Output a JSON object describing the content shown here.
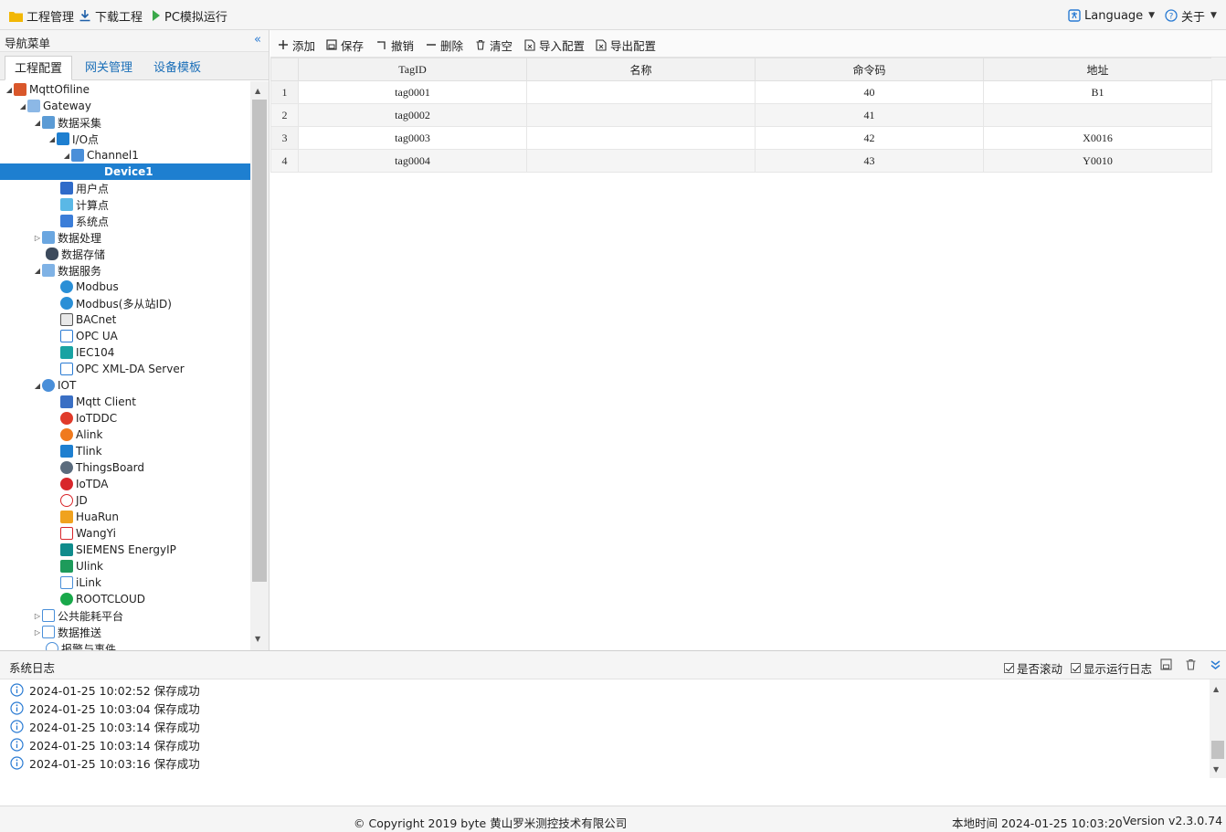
{
  "menubar": {
    "project": "工程管理",
    "download": "下载工程",
    "simulate": "PC模拟运行",
    "language": "Language",
    "about": "关于"
  },
  "nav": {
    "title": "导航菜单",
    "tabs": [
      "工程配置",
      "网关管理",
      "设备模板"
    ],
    "tree": [
      {
        "label": "MqttOfiline",
        "icon": "project-icon"
      },
      {
        "label": "Gateway",
        "icon": "gateway-icon"
      },
      {
        "label": "数据采集",
        "icon": "collect-icon"
      },
      {
        "label": "I/O点",
        "icon": "io-icon"
      },
      {
        "label": "Channel1",
        "icon": "channel-icon"
      },
      {
        "label": "Device1",
        "icon": "device-icon"
      },
      {
        "label": "用户点",
        "icon": "user-point-icon"
      },
      {
        "label": "计算点",
        "icon": "calc-point-icon"
      },
      {
        "label": "系统点",
        "icon": "system-point-icon"
      },
      {
        "label": "数据处理",
        "icon": "process-icon"
      },
      {
        "label": "数据存储",
        "icon": "database-icon"
      },
      {
        "label": "数据服务",
        "icon": "service-icon"
      },
      {
        "label": "Modbus",
        "icon": "modbus-icon"
      },
      {
        "label": "Modbus(多从站ID)",
        "icon": "modbus-icon"
      },
      {
        "label": "BACnet",
        "icon": "bacnet-icon"
      },
      {
        "label": "OPC UA",
        "icon": "opcua-icon"
      },
      {
        "label": "IEC104",
        "icon": "iec104-icon"
      },
      {
        "label": "OPC XML-DA Server",
        "icon": "opcxml-icon"
      },
      {
        "label": "IOT",
        "icon": "iot-icon"
      },
      {
        "label": "Mqtt Client",
        "icon": "mqtt-icon"
      },
      {
        "label": "IoTDDC",
        "icon": "iotddc-icon"
      },
      {
        "label": "Alink",
        "icon": "alink-icon"
      },
      {
        "label": "Tlink",
        "icon": "tlink-icon"
      },
      {
        "label": "ThingsBoard",
        "icon": "thingsboard-icon"
      },
      {
        "label": "IoTDA",
        "icon": "huawei-icon"
      },
      {
        "label": "JD",
        "icon": "jd-icon"
      },
      {
        "label": "HuaRun",
        "icon": "huarun-icon"
      },
      {
        "label": "WangYi",
        "icon": "wangyi-icon"
      },
      {
        "label": "SIEMENS EnergyIP",
        "icon": "siemens-icon"
      },
      {
        "label": "Ulink",
        "icon": "ulink-icon"
      },
      {
        "label": "iLink",
        "icon": "ilink-icon"
      },
      {
        "label": "ROOTCLOUD",
        "icon": "rootcloud-icon"
      },
      {
        "label": "公共能耗平台",
        "icon": "energy-platform-icon"
      },
      {
        "label": "数据推送",
        "icon": "push-icon"
      },
      {
        "label": "报警与事件",
        "icon": "alarm-icon"
      }
    ]
  },
  "toolbar": {
    "add": "添加",
    "save": "保存",
    "undo": "撤销",
    "delete": "删除",
    "clear": "清空",
    "import": "导入配置",
    "export": "导出配置"
  },
  "grid": {
    "columns": [
      "TagID",
      "名称",
      "命令码",
      "地址"
    ],
    "rows": [
      {
        "n": "1",
        "tag": "tag0001",
        "name": "",
        "cmd": "40",
        "addr": "B1"
      },
      {
        "n": "2",
        "tag": "tag0002",
        "name": "",
        "cmd": "41",
        "addr": ""
      },
      {
        "n": "3",
        "tag": "tag0003",
        "name": "",
        "cmd": "42",
        "addr": "X0016"
      },
      {
        "n": "4",
        "tag": "tag0004",
        "name": "",
        "cmd": "43",
        "addr": "Y0010"
      }
    ]
  },
  "log": {
    "title": "系统日志",
    "scroll_label": "是否滚动",
    "show_run_label": "显示运行日志",
    "lines": [
      "2024-01-25 10:02:52 保存成功",
      "2024-01-25 10:03:04 保存成功",
      "2024-01-25 10:03:14 保存成功",
      "2024-01-25 10:03:14 保存成功",
      "2024-01-25 10:03:16 保存成功"
    ]
  },
  "footer": {
    "copyright": "© Copyright 2019 byte 黄山罗米测控技术有限公司",
    "local_time": "本地时间 2024-01-25 10:03:20",
    "version": "Version v2.3.0.74"
  },
  "colors": {
    "accent": "#1e7fd0",
    "link": "#1b6fb8"
  }
}
